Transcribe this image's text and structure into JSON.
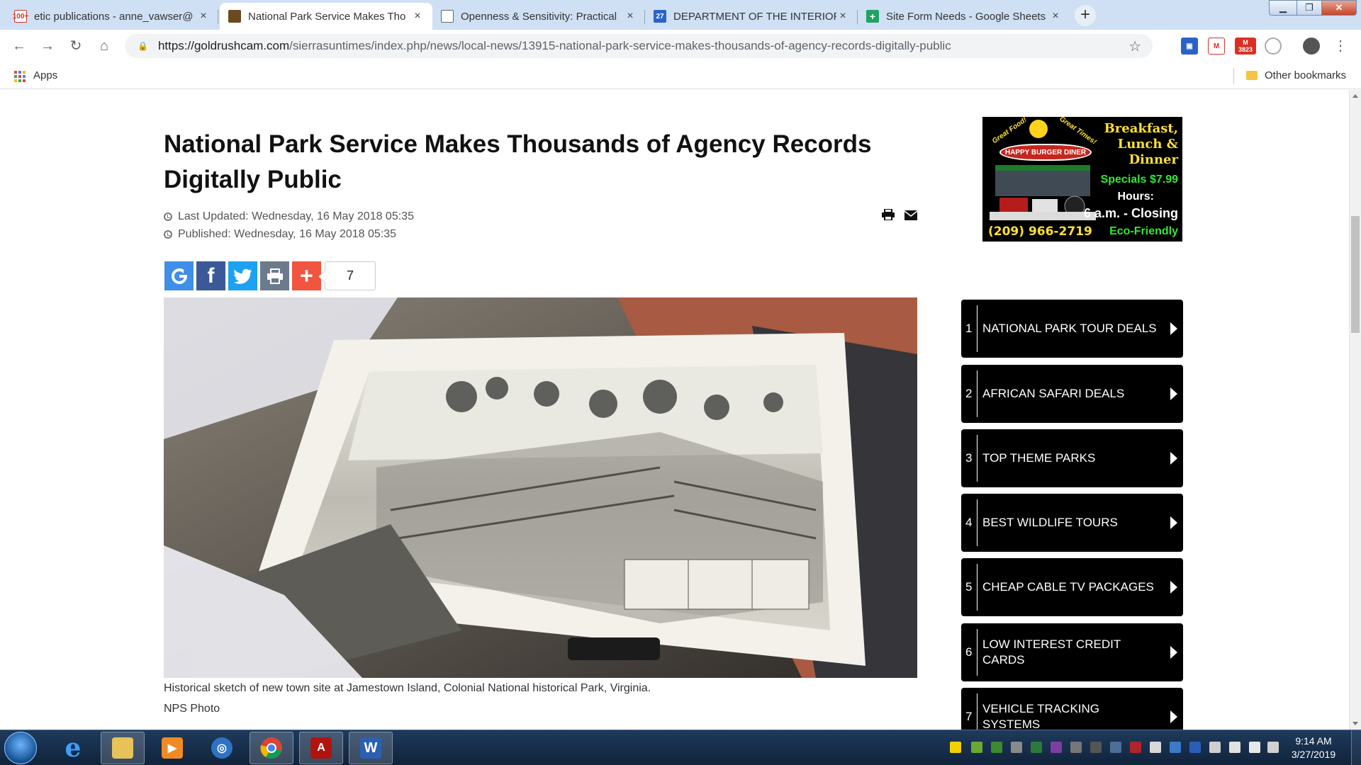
{
  "browser": {
    "tabs": [
      {
        "title": "etic publications - anne_vawser@",
        "favicon": "gmail-icon",
        "favicon_text": "100+",
        "favicon_color": "#d93025",
        "active": false
      },
      {
        "title": "National Park Service Makes Tho",
        "favicon": "site-favicon-icon",
        "favicon_text": "",
        "favicon_color": "#6b4a1e",
        "active": true
      },
      {
        "title": "Openness & Sensitivity: Practical",
        "favicon": "document-icon",
        "favicon_text": "",
        "favicon_color": "#ffffff",
        "active": false
      },
      {
        "title": "DEPARTMENT OF THE INTERIOR",
        "favicon": "calendar-icon",
        "favicon_text": "27",
        "favicon_color": "#2a63c8",
        "active": false
      },
      {
        "title": "Site Form Needs - Google Sheets",
        "favicon": "sheets-icon",
        "favicon_text": "",
        "favicon_color": "#1ea362",
        "active": false
      }
    ],
    "close_glyph": "×",
    "new_tab_glyph": "+",
    "url_host": "https://goldrushcam.com",
    "url_path": "/sierrasuntimes/index.php/news/local-news/13915-national-park-service-makes-thousands-of-agency-records-digitally-public",
    "gmail_badge_count": "3823",
    "bookmarks": {
      "apps_label": "Apps",
      "other_label": "Other bookmarks"
    }
  },
  "article": {
    "title": "National Park Service Makes Thousands of Agency Records Digitally Public",
    "last_updated": "Last Updated: Wednesday, 16 May 2018 05:35",
    "published": "Published: Wednesday, 16 May 2018 05:35",
    "share_count": "7",
    "share_buttons": [
      {
        "name": "google-share-icon",
        "glyph": "G",
        "color": "#3f8ee8"
      },
      {
        "name": "facebook-share-icon",
        "glyph": "f",
        "color": "#3b5998"
      },
      {
        "name": "twitter-share-icon",
        "glyph": "t",
        "color": "#1da1f2"
      },
      {
        "name": "print-share-icon",
        "glyph": "⎙",
        "color": "#6b7b8c"
      },
      {
        "name": "more-share-icon",
        "glyph": "+",
        "color": "#f1543f"
      }
    ],
    "photo_caption": "Historical sketch of new town site at Jamestown Island, Colonial National historical Park, Virginia.",
    "photo_credit": "NPS Photo"
  },
  "ad": {
    "headline": "Breakfast, Lunch & Dinner",
    "special": "Specials $7.99",
    "hours_label": "Hours:",
    "hours": "6 a.m. - Closing",
    "phone": "(209) 966-2719",
    "eco": "Eco-Friendly",
    "badge": "HAPPY BURGER DINER",
    "tag_left": "Great Food!",
    "tag_right": "Great Times!"
  },
  "sidebar_links": [
    {
      "num": "1",
      "label": "NATIONAL PARK TOUR DEALS"
    },
    {
      "num": "2",
      "label": "AFRICAN SAFARI DEALS"
    },
    {
      "num": "3",
      "label": "TOP THEME PARKS"
    },
    {
      "num": "4",
      "label": "BEST WILDLIFE TOURS"
    },
    {
      "num": "5",
      "label": "CHEAP CABLE TV PACKAGES"
    },
    {
      "num": "6",
      "label": "LOW INTEREST CREDIT CARDS"
    },
    {
      "num": "7",
      "label": "VEHICLE TRACKING SYSTEMS"
    }
  ],
  "taskbar": {
    "apps": [
      {
        "name": "internet-explorer-icon",
        "glyph": "e",
        "color": "#1f7fd8",
        "active": false
      },
      {
        "name": "file-explorer-icon",
        "glyph": "",
        "color": "#e7c25a",
        "active": true
      },
      {
        "name": "media-player-icon",
        "glyph": "▶",
        "color": "#f08a24",
        "active": false
      },
      {
        "name": "network-globe-icon",
        "glyph": "◎",
        "color": "#2f72c4",
        "active": false
      },
      {
        "name": "chrome-icon",
        "glyph": "",
        "color": "#db4437",
        "active": true
      },
      {
        "name": "acrobat-icon",
        "glyph": "A",
        "color": "#b0140f",
        "active": true
      },
      {
        "name": "word-icon",
        "glyph": "W",
        "color": "#2b5fb4",
        "active": true
      }
    ],
    "time": "9:14 AM",
    "date": "3/27/2019"
  }
}
